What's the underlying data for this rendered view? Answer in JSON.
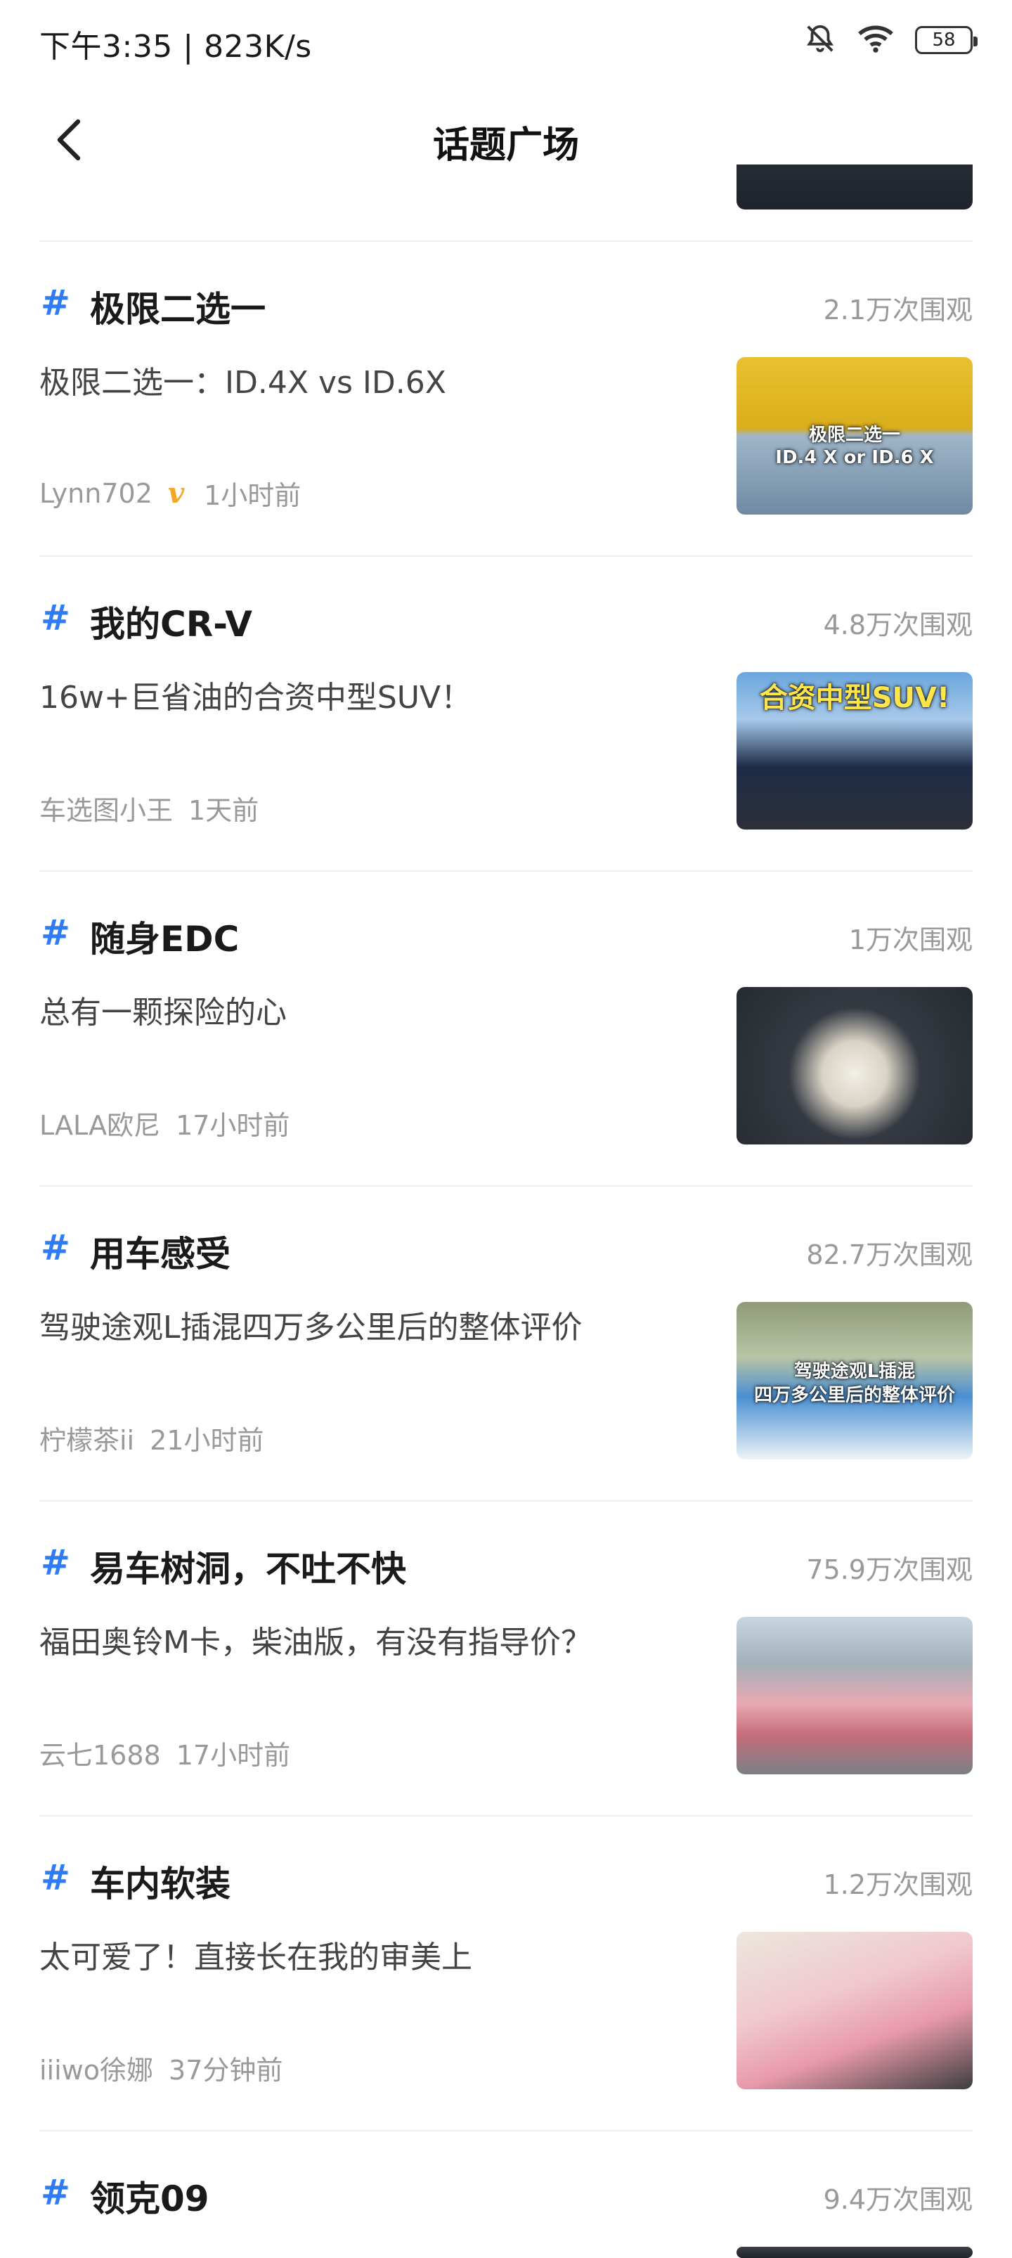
{
  "status_bar": {
    "time": "下午3:35 | 823K/s",
    "icons": [
      "mute-bell-icon",
      "wifi-icon",
      "battery-icon"
    ],
    "battery": "58"
  },
  "nav": {
    "back_icon": "chevron-left-icon",
    "title": "话题广场"
  },
  "accent_color": "#2f7cf6",
  "topics": [
    {
      "name": "极限二选一",
      "views": "2.1万次围观",
      "desc": "极限二选一：ID.4X vs ID.6X",
      "author": "Lynn702",
      "verified": "v",
      "time": "1小时前",
      "thumb_caption_1": "极限二选一",
      "thumb_caption_2": "ID.4 X or ID.6 X"
    },
    {
      "name": "我的CR-V",
      "views": "4.8万次围观",
      "desc": "16w+巨省油的合资中型SUV！",
      "author": "车选图小王",
      "time": "1天前",
      "thumb_caption_1": "合资中型SUV!"
    },
    {
      "name": "随身EDC",
      "views": "1万次围观",
      "desc": "总有一颗探险的心",
      "author": "LALA欧尼",
      "time": "17小时前"
    },
    {
      "name": "用车感受",
      "views": "82.7万次围观",
      "desc": "驾驶途观L插混四万多公里后的整体评价",
      "author": "柠檬茶ii",
      "time": "21小时前",
      "thumb_caption_1": "驾驶途观L插混",
      "thumb_caption_2": "四万多公里后的整体评价"
    },
    {
      "name": "易车树洞，不吐不快",
      "views": "75.9万次围观",
      "desc": "福田奥铃M卡，柴油版，有没有指导价？",
      "author": "云七1688",
      "time": "17小时前"
    },
    {
      "name": "车内软装",
      "views": "1.2万次围观",
      "desc": "太可爱了！直接长在我的审美上",
      "author": "iiiwo徐娜",
      "time": "37分钟前"
    },
    {
      "name": "领克09",
      "views": "9.4万次围观"
    }
  ]
}
